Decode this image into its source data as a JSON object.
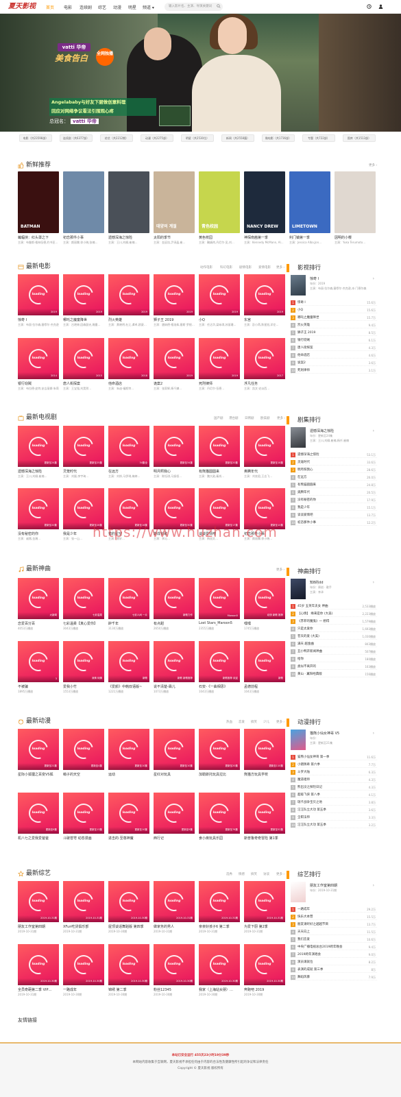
{
  "site": {
    "logo": "夏天影视",
    "nav": [
      "首页",
      "电影",
      "连续剧",
      "综艺",
      "动漫",
      "明星",
      "频道 ▾"
    ],
    "search_placeholder": "输入影片名、主演、导演关键词"
  },
  "banner": {
    "ad_brand": "vatti 华帝",
    "ad_slogan": "美食告白",
    "ad_badge": "全网独播",
    "caption_line1": "Angelababy与好友下厨做创意料理",
    "caption_line2": "回应对网络争议看法引围观心疼",
    "sponsor_label": "总冠名：",
    "sponsor_brand": "vatti 华帝"
  },
  "tags": [
    "电影（共23598部）",
    "连续剧（共6377部）",
    "综艺（共2212期）",
    "动漫（共2275部）",
    "明星（共2530位）",
    "新闻（共2558篇）",
    "微电影（共1736部）",
    "专题（共722部）",
    "图库（共1513部）"
  ],
  "fresh": {
    "title": "新鲜推荐",
    "more": "更多 ›",
    "items": [
      {
        "title": "蝙蝠侠：红头罩之下",
        "sub": "主演：布鲁斯·格林伍德,约书亚…",
        "art": "BATMAN",
        "bg": "#3a1010"
      },
      {
        "title": "初恋那件小事",
        "sub": "主演：颜丽霖,徐小晓,张楠…",
        "art": "",
        "bg": "#6f8aa8"
      },
      {
        "title": "遗憾深海之惊险",
        "sub": "主演：王川,刘柳,崔楠…",
        "art": "",
        "bg": "#4a5058"
      },
      {
        "title": "太阳的季节",
        "sub": "主演：金廷炫,尹谆晶,崔…",
        "art": "태양의 계절",
        "bg": "#c9b49a"
      },
      {
        "title": "黄色校园",
        "sub": "主演：鞠婧祎,丹尼尔·吴,刘…",
        "art": "青色校园",
        "bg": "#c6d64d"
      },
      {
        "title": "神探南茜第一季",
        "sub": "主演：Kennedy McMann, Al…",
        "art": "NANCY DREW",
        "bg": "#1e2a3c"
      },
      {
        "title": "利门镇第一季",
        "sub": "主演：Jessica Alba,Jon…",
        "art": "LIMETOWN",
        "bg": "#3b6ac1"
      },
      {
        "title": "因明的小樱",
        "sub": "主演：Yuka Terumoto…",
        "art": "",
        "bg": "#e0d8d0"
      }
    ]
  },
  "movies": {
    "title": "最新电影",
    "tabs": [
      "动作电影",
      "科幻电影",
      "剧情电影",
      "爱情电影"
    ],
    "more": "更多 ›",
    "items": [
      {
        "title": "惊奇 I",
        "sub": "主演：布丽·拉尔森,塞缪尔·杰克逊…",
        "badge": "2019"
      },
      {
        "title": "哪吒之魔童降世",
        "sub": "主演：吕艳婷,囧森瑟夫,瀚墨…",
        "badge": "2019"
      },
      {
        "title": "烈火英雄",
        "sub": "主演：黄晓明,杜江,谭卓,欧豪…",
        "badge": "2019"
      },
      {
        "title": "狮子王 2019",
        "sub": "主演：唐纳德·格洛弗,塞斯·罗根…",
        "badge": "2019"
      },
      {
        "title": "小Q",
        "sub": "主演：任达华,梁咏琪,苏丽珊…",
        "badge": "2019"
      },
      {
        "title": "东宫",
        "sub": "主演：彭小苒,陈星旭,邓伦…",
        "badge": "2019"
      },
      {
        "title": "银行窃贼",
        "sub": "主演：布拉德·皮特,安吉丽娜·朱莉…",
        "badge": "2014"
      },
      {
        "title": "唐人街探案",
        "sub": "主演：王宝强,刘昊然…",
        "badge": "2015"
      },
      {
        "title": "他命酒店",
        "sub": "主演：朱迪·福斯特…",
        "badge": "2018"
      },
      {
        "title": "诡案2",
        "sub": "主演：张家辉,杨千嬅…",
        "badge": "2019"
      },
      {
        "title": "死刑律师",
        "sub": "主演：丹尼尔·伍德…",
        "badge": "2019"
      },
      {
        "title": "浮凡任务",
        "sub": "主演：凯文·史派西…",
        "badge": "2017"
      }
    ]
  },
  "movie_rank": {
    "title": "影视排行",
    "feat_title": "惊奇 I",
    "feat_year": "年份：2019",
    "feat_cast": "主演：布丽·拉尔森,塞缪尔·杰克逊,本·门德尔森",
    "items": [
      {
        "name": "惊奇 I",
        "count": "15.6万"
      },
      {
        "name": "小Q",
        "count": "15.6万"
      },
      {
        "name": "哪吒之魔童降世",
        "count": "15.7万"
      },
      {
        "name": "烈火英雄",
        "count": "9.4万"
      },
      {
        "name": "狮子王 2019",
        "count": "8.5万"
      },
      {
        "name": "银行窃贼",
        "count": "6.1万"
      },
      {
        "name": "唐人街探案",
        "count": "4.3万"
      },
      {
        "name": "他命酒店",
        "count": "4.6万"
      },
      {
        "name": "诡案2",
        "count": "3.6万"
      },
      {
        "name": "死刑律师",
        "count": "3.1万"
      }
    ]
  },
  "tv": {
    "title": "最新电视剧",
    "tabs": [
      "国产剧",
      "港台剧",
      "日韩剧",
      "欧美剧"
    ],
    "more": "更多 ›",
    "items": [
      {
        "title": "遗憾深海之惊险",
        "sub": "主演：王川,刘柳,崔楠…",
        "badge": "更新至24集"
      },
      {
        "title": "灵笼时代",
        "sub": "主演：刘颖,李宇琦…",
        "badge": "更新至25集"
      },
      {
        "title": "在远方",
        "sub": "主演：刘烨,马伊琍,梅婷…",
        "badge": "34集全"
      },
      {
        "title": "明月照我心",
        "sub": "主演：陈钰琪,马振桓…",
        "badge": "更新至34集"
      },
      {
        "title": "有熊猫圆圆来",
        "sub": "主演：魏大勋,秦岚…",
        "badge": "更新至20集"
      },
      {
        "title": "奥腾年代",
        "sub": "主演：刘奕君,王志飞…",
        "badge": "更新至18集"
      },
      {
        "title": "没有秘密的你",
        "sub": "主演：戚薇,金瀚…",
        "badge": "更新至20集"
      },
      {
        "title": "我是少年",
        "sub": "主演：张一山…",
        "badge": "更新至28集"
      },
      {
        "title": "猎豹星空",
        "sub": "主演：黄轩…",
        "badge": "更新至16集"
      },
      {
        "title": "斯成长歌",
        "sub": "主演：李沁…",
        "badge": "更新至30集"
      },
      {
        "title": "谈谈爱情吧",
        "sub": "主演：杨旭文…",
        "badge": "更新至17集"
      },
      {
        "title": "初恋那件小事",
        "sub": "主演：颜丽霖,徐小晓…",
        "badge": "更新至10集"
      }
    ]
  },
  "tv_rank": {
    "title": "剧集排行",
    "feat_title": "遗憾深海之惊险",
    "feat_year": "年份：更新至24集",
    "feat_cast": "主演：王川,刘柳,崔楠,杨仟,崔楠",
    "items": [
      {
        "name": "遗憾深海之惊险",
        "count": "53.1万"
      },
      {
        "name": "灵笼时代",
        "count": "33.6万"
      },
      {
        "name": "明月照我心",
        "count": "28.6万"
      },
      {
        "name": "在远方",
        "count": "26.0万"
      },
      {
        "name": "有熊猫圆圆来",
        "count": "24.8万"
      },
      {
        "name": "奥腾年代",
        "count": "20.5万"
      },
      {
        "name": "没有秘密的你",
        "count": "17.9万"
      },
      {
        "name": "我是少年",
        "count": "15.1万"
      },
      {
        "name": "谈谈爱情吧",
        "count": "13.7万"
      },
      {
        "name": "初恋那件小事",
        "count": "12.2万"
      }
    ]
  },
  "music": {
    "title": "最新神曲",
    "more": "更多 ›",
    "items": [
      {
        "title": "恋爱百分百",
        "sub": "4053万播放",
        "badge": "大新闻"
      },
      {
        "title": "七彩温柔【真心爱你】",
        "sub": "3043万播放",
        "badge": "七彩温柔"
      },
      {
        "title": "醉千年",
        "sub": "3130万播放",
        "badge": "七彩人间 一片"
      },
      {
        "title": "有点甜",
        "sub": "2650万播放",
        "badge": "新歌力作"
      },
      {
        "title": "Lost Stars_Maroon5",
        "sub": "2355万播放",
        "badge": "Maroon5"
      },
      {
        "title": "嘿嘿",
        "sub": "1745万播放",
        "badge": "欢快 新歌 推荐"
      },
      {
        "title": "不被骗",
        "sub": "1895万播放",
        "badge": "3"
      },
      {
        "title": "爱我小竹",
        "sub": "1553万播放",
        "badge": "深情 纯情"
      },
      {
        "title": "《爱颜》中韩双语版~",
        "sub": "1221万播放",
        "badge": "新歌"
      },
      {
        "title": "说不清楚-霖儿",
        "sub": "1073万播放",
        "badge": "新歌 新歌推荐"
      },
      {
        "title": "石安-《一曲相思》",
        "sub": "1043万播放",
        "badge": "新歌推荐 欢迎"
      },
      {
        "title": "孟德前程",
        "sub": "1043万播放",
        "badge": "新歌"
      }
    ]
  },
  "music_rank": {
    "title": "神曲排行",
    "feat_title": "知8的dd",
    "feat_year": "年份：原创 · 歌手",
    "feat_cast": "主演：李泽",
    "items": [
      {
        "name": "45岁 五英年夫女 神曲",
        "count": "2,533播放"
      },
      {
        "name": "【心情】 缘来是你 (大美)",
        "count": "2,223播放"
      },
      {
        "name": "《苏菲的魔鬼》一 想得",
        "count": "1,579播放"
      },
      {
        "name": "只是太爱你",
        "count": "1,693播放"
      },
      {
        "name": "苍天的爱 (大美)",
        "count": "1,030播放"
      },
      {
        "name": "满天 越金曲",
        "count": "843播放"
      },
      {
        "name": "丑小鸭开新闻神曲",
        "count": "507播放"
      },
      {
        "name": "给你",
        "count": "180播放"
      },
      {
        "name": "类似不离开的",
        "count": "163播放"
      },
      {
        "name": "黄山 · 翼阳经典版",
        "count": "156播放"
      }
    ]
  },
  "anime": {
    "title": "最新动漫",
    "tabs": [
      "热血",
      "恋爱",
      "搞笑",
      "少儿"
    ],
    "more": "更多 ›",
    "items": [
      {
        "title": "星际小狐狸之百变VS狐",
        "sub": "",
        "badge": "更新至21集"
      },
      {
        "title": "萌子的天空",
        "sub": "",
        "badge": "更新至4集"
      },
      {
        "title": "运动",
        "sub": "",
        "badge": "更新至10集"
      },
      {
        "title": "星红对玩具",
        "sub": "",
        "badge": "更新至10集"
      },
      {
        "title": "加勒斯托玩具拉比",
        "sub": "",
        "badge": "更新至20集"
      },
      {
        "title": "熊猫方玩具学校",
        "sub": "",
        "badge": "更新至110集"
      },
      {
        "title": "机八七之爱我爱爸爸",
        "sub": "",
        "badge": "更新至8集"
      },
      {
        "title": "斗破苍穹 动态漫画",
        "sub": "",
        "badge": "更新至13集"
      },
      {
        "title": "进击的·至尊神魔",
        "sub": "",
        "badge": "更新至10集"
      },
      {
        "title": "西行记",
        "sub": "",
        "badge": "更新至9集"
      },
      {
        "title": "食小疾玩具乐园",
        "sub": "",
        "badge": "更新至76集"
      },
      {
        "title": "斯普鲁奇奇冒险 第1季",
        "sub": "",
        "badge": "更新至52集"
      }
    ]
  },
  "anime_rank": {
    "title": "动漫排行",
    "feat_title": "猫熊小仙女神哥 V5",
    "feat_year": "年份：",
    "feat_cast": "主演：更新至21集",
    "items": [
      {
        "name": "猫熊小仙女神哥 第一季",
        "count": "11.6万"
      },
      {
        "name": "小猪佩奇 第六季",
        "count": "7.7万"
      },
      {
        "name": "斗罗大陆",
        "count": "6.3万"
      },
      {
        "name": "魔道祖师",
        "count": "4.3万"
      },
      {
        "name": "熊出没之探险日记",
        "count": "4.3万"
      },
      {
        "name": "超级飞侠 第八季",
        "count": "4.1万"
      },
      {
        "name": "瑞卡战争宝贝之地",
        "count": "3.8万"
      },
      {
        "name": "汪汪队立大功 第五季",
        "count": "3.6万"
      },
      {
        "name": "全职法师",
        "count": "3.3万"
      },
      {
        "name": "汪汪队立大功 第五季",
        "count": "3.2万"
      }
    ]
  },
  "variety": {
    "title": "最新综艺",
    "tabs": [
      "选秀",
      "情感",
      "搞笑",
      "访谈"
    ],
    "more": "更多 ›",
    "items": [
      {
        "title": "朋友工作室第四期",
        "sub": "2019-10-31期",
        "badge": "2019-10-31期"
      },
      {
        "title": "XFun吃货俱乐部",
        "sub": "2019-10-31期",
        "badge": "2019-10-31期"
      },
      {
        "title": "屋顶谈话舞蹈版 第四季",
        "sub": "2019-10-30期",
        "badge": "2019-10-30期"
      },
      {
        "title": "做家务的男人",
        "sub": "2019-10-31期",
        "badge": "2019-10-31期"
      },
      {
        "title": "亲亲好孩子6 第二季",
        "sub": "2019-10-31期",
        "badge": "2019-10-31期"
      },
      {
        "title": "为爱下厨 第2季",
        "sub": "2019-10-31期",
        "badge": "2019-10-31期"
      },
      {
        "title": "全员奇葩第二季 VIP…",
        "sub": "2019-10-31期",
        "badge": "2019-10-30期"
      },
      {
        "title": "一路成年",
        "sub": "2019-10-30期",
        "badge": "2019-10-30期"
      },
      {
        "title": "锦绣 第二季",
        "sub": "2019-10-30期",
        "badge": "2019-10-30期"
      },
      {
        "title": "粉丝12345",
        "sub": "2019-10-30期",
        "badge": "2019-10-30期"
      },
      {
        "title": "我家（上海站女朋）…",
        "sub": "2019-10-30期",
        "badge": "2019-10-30期"
      },
      {
        "title": "奔跑吧 2019",
        "sub": "2019-10-30期",
        "badge": "2019-10-30期"
      }
    ]
  },
  "variety_rank": {
    "title": "综艺排行",
    "feat_title": "朋友工作室第四期",
    "feat_year": "年份：2019-10-31期",
    "feat_cast": "",
    "items": [
      {
        "name": "一路成年",
        "count": "29.2万"
      },
      {
        "name": "快乐大本营",
        "count": "15.5万"
      },
      {
        "name": "朋友请听好之越越节目",
        "count": "13.7万"
      },
      {
        "name": "天天向上",
        "count": "11.5万"
      },
      {
        "name": "我们恋爱",
        "count": "10.6万"
      },
      {
        "name": "中央广播电视总台2019跨年晚会",
        "count": "9.4万"
      },
      {
        "name": "2019跨年演唱会",
        "count": "9.0万"
      },
      {
        "name": "演员请就位",
        "count": "8.2万"
      },
      {
        "name": "表演的成就 第三季",
        "count": "8万"
      },
      {
        "name": "舞蹈风暴",
        "count": "7.9万"
      }
    ]
  },
  "footer": {
    "links_title": "友情链接",
    "run_text": "本站已安全运行 455天23小时19分39秒",
    "disclaimer": "本网站内容收集于互联网，夏天影视不承担任何由于内容的合法性及健康性所引起的争议和法律责任",
    "copyright": "Copyright © 夏天影视 版权所有"
  },
  "watermark": "https://www.huzhan.com",
  "colors": {
    "accent": "#ff9900",
    "card_top": "#ff5a5f",
    "card_bottom": "#e8125e",
    "rank_hot": "#e64b3c",
    "rank_warm": "#f39c12"
  }
}
